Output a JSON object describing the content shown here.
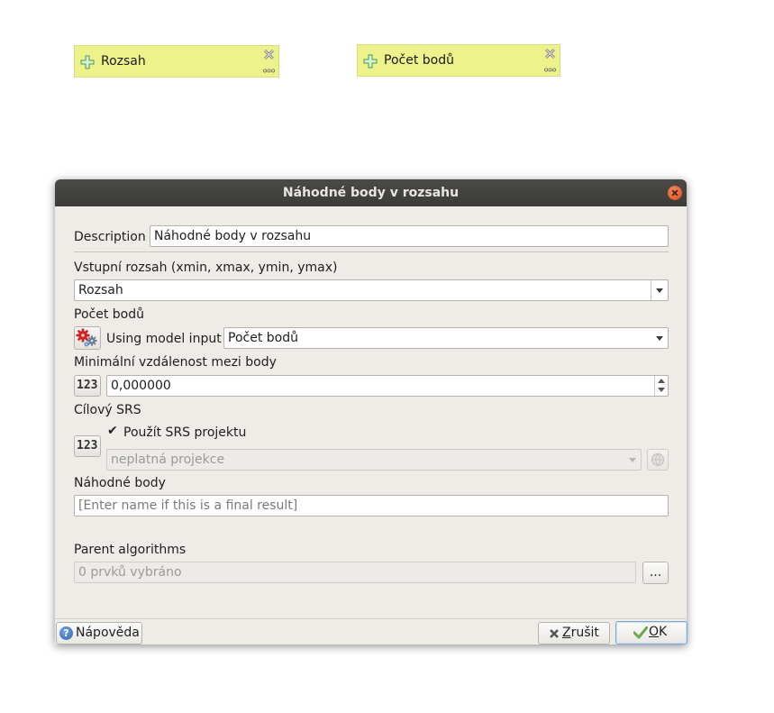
{
  "canvas": {
    "nodes": [
      {
        "label": "Rozsah",
        "icon": "plus-icon",
        "color": "#eef28b"
      },
      {
        "label": "Počet bodů",
        "icon": "plus-icon",
        "color": "#eef28b"
      }
    ]
  },
  "dialog": {
    "title": "Náhodné body v rozsahu",
    "description_label": "Description",
    "description_value": "Náhodné body v rozsahu",
    "extent_label": "Vstupní rozsah (xmin, xmax, ymin, ymax)",
    "extent_value": "Rozsah",
    "point_count_label": "Počet bodů",
    "point_count_mode": "Using model input",
    "point_count_value": "Počet bodů",
    "min_distance_label": "Minimální vzdálenost mezi body",
    "min_distance_value": "0,000000",
    "target_crs_label": "Cílový SRS",
    "use_project_crs_label": "Použít SRS projektu",
    "use_project_crs_checked": true,
    "crs_value": "neplatná projekce",
    "output_label": "Náhodné body",
    "output_placeholder": "[Enter name if this is a final result]",
    "parent_algorithms_label": "Parent algorithms",
    "parent_algorithms_value": "0 prvků vybráno",
    "browse_label": "...",
    "help_label": "Nápověda",
    "cancel_label": "Zrušit",
    "ok_label": "OK",
    "number_icon_text": "123"
  },
  "colors": {
    "node_fill": "#eef28b",
    "titlebar": "#3c3b37",
    "close_button": "#dd4814",
    "dialog_bg": "#efebe7"
  }
}
